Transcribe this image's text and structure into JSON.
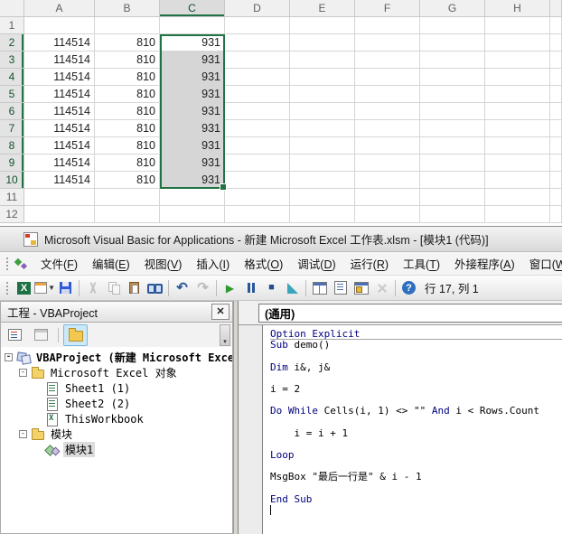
{
  "excel": {
    "columns": [
      "A",
      "B",
      "C",
      "D",
      "E",
      "F",
      "G",
      "H"
    ],
    "row_numbers": [
      "1",
      "2",
      "3",
      "4",
      "5",
      "6",
      "7",
      "8",
      "9",
      "10",
      "11",
      "12"
    ],
    "rows": [
      {
        "n": 2,
        "A": "114514",
        "B": "810",
        "C": "931"
      },
      {
        "n": 3,
        "A": "114514",
        "B": "810",
        "C": "931"
      },
      {
        "n": 4,
        "A": "114514",
        "B": "810",
        "C": "931"
      },
      {
        "n": 5,
        "A": "114514",
        "B": "810",
        "C": "931"
      },
      {
        "n": 6,
        "A": "114514",
        "B": "810",
        "C": "931"
      },
      {
        "n": 7,
        "A": "114514",
        "B": "810",
        "C": "931"
      },
      {
        "n": 8,
        "A": "114514",
        "B": "810",
        "C": "931"
      },
      {
        "n": 9,
        "A": "114514",
        "B": "810",
        "C": "931"
      },
      {
        "n": 10,
        "A": "114514",
        "B": "810",
        "C": "931"
      }
    ],
    "selection": "C2:C10",
    "colors": {
      "accent_green": "#217346",
      "selection_fill": "#d6d6d6"
    }
  },
  "vba": {
    "title": "Microsoft Visual Basic for Applications - 新建 Microsoft Excel 工作表.xlsm - [模块1 (代码)]",
    "menus": [
      "文件(F)",
      "编辑(E)",
      "视图(V)",
      "插入(I)",
      "格式(O)",
      "调试(D)",
      "运行(R)",
      "工具(T)",
      "外接程序(A)",
      "窗口(W)"
    ],
    "toolbar": {
      "items": [
        {
          "name": "view-excel-button",
          "icon": "excel-icon",
          "kind": "ic-excel",
          "glyph": "X"
        },
        {
          "name": "insert-userform-button",
          "icon": "userform-icon",
          "kind": "ic-userform",
          "dropdown": true
        },
        {
          "name": "save-button",
          "icon": "save-icon",
          "kind": "ic-save"
        },
        {
          "sep": true
        },
        {
          "name": "cut-button",
          "icon": "scissors-icon",
          "kind": "ic-cut",
          "disabled": true
        },
        {
          "name": "copy-button",
          "icon": "copy-icon",
          "kind": "ic-copy",
          "disabled": true
        },
        {
          "name": "paste-button",
          "icon": "clipboard-icon",
          "kind": "ic-paste"
        },
        {
          "name": "find-button",
          "icon": "binoculars-icon",
          "kind": "ic-find"
        },
        {
          "sep": true
        },
        {
          "name": "undo-button",
          "icon": "undo-arrow-icon",
          "kind": "g-undo",
          "glyph": "↶"
        },
        {
          "name": "redo-button",
          "icon": "redo-arrow-icon",
          "kind": "g-redo",
          "glyph": "↷",
          "disabled": true
        },
        {
          "sep": true
        },
        {
          "name": "run-button",
          "icon": "play-icon",
          "kind": "g-run",
          "glyph": "▶"
        },
        {
          "name": "break-button",
          "icon": "pause-icon",
          "kind": "ic-break",
          "bars": true
        },
        {
          "name": "reset-button",
          "icon": "stop-icon",
          "kind": "g-reset",
          "glyph": "■"
        },
        {
          "name": "design-mode-button",
          "icon": "design-mode-icon",
          "kind": "ic-design"
        },
        {
          "sep": true
        },
        {
          "name": "project-explorer-button",
          "icon": "project-explorer-icon",
          "kind": "ic-projexp"
        },
        {
          "name": "properties-window-button",
          "icon": "properties-icon",
          "kind": "ic-props"
        },
        {
          "name": "object-browser-button",
          "icon": "object-browser-icon",
          "kind": "ic-objbrowser"
        },
        {
          "name": "toolbox-button",
          "icon": "toolbox-icon",
          "kind": "ic-toolbox",
          "disabled": true
        },
        {
          "sep": true
        },
        {
          "name": "help-button",
          "icon": "help-icon",
          "kind": "ic-help",
          "glyph": "?"
        }
      ],
      "status": "行 17, 列 1"
    },
    "project": {
      "header": "工程 - VBAProject",
      "tree": [
        {
          "icon": "project-icon",
          "kind": "ti-project",
          "label": "VBAProject (新建 Microsoft Excel 工作表.xlsm)",
          "bold": true,
          "level": 0,
          "expander": "-"
        },
        {
          "icon": "folder-icon",
          "kind": "ti-folder",
          "label": "Microsoft Excel 对象",
          "level": 1,
          "expander": "-"
        },
        {
          "icon": "worksheet-icon",
          "kind": "ti-sheet",
          "label": "Sheet1 (1)",
          "level": 2
        },
        {
          "icon": "worksheet-icon",
          "kind": "ti-sheet",
          "label": "Sheet2 (2)",
          "level": 2
        },
        {
          "icon": "workbook-icon",
          "kind": "ti-workbook",
          "label": "ThisWorkbook",
          "level": 2
        },
        {
          "icon": "folder-icon",
          "kind": "ti-folder",
          "label": "模块",
          "level": 1,
          "expander": "-"
        },
        {
          "icon": "module-icon",
          "kind": "ti-module",
          "label": "模块1",
          "level": 2,
          "selected": true
        }
      ]
    },
    "code": {
      "object_dropdown": "(通用)",
      "lines": [
        {
          "seg": [
            [
              "kw",
              "Option Explicit"
            ]
          ],
          "sep": true
        },
        {
          "seg": [
            [
              "kw",
              "Sub"
            ],
            [
              "tx",
              " demo()"
            ]
          ]
        },
        {
          "seg": []
        },
        {
          "seg": [
            [
              "kw",
              "Dim"
            ],
            [
              "tx",
              " i&, j&"
            ]
          ]
        },
        {
          "seg": []
        },
        {
          "seg": [
            [
              "tx",
              "i = 2"
            ]
          ]
        },
        {
          "seg": []
        },
        {
          "seg": [
            [
              "kw",
              "Do While"
            ],
            [
              "tx",
              " Cells(i, 1) <> \"\" "
            ],
            [
              "kw",
              "And"
            ],
            [
              "tx",
              " i < Rows.Count"
            ]
          ]
        },
        {
          "seg": []
        },
        {
          "seg": [
            [
              "tx",
              "    i = i + 1"
            ]
          ]
        },
        {
          "seg": []
        },
        {
          "seg": [
            [
              "kw",
              "Loop"
            ]
          ]
        },
        {
          "seg": []
        },
        {
          "seg": [
            [
              "tx",
              "MsgBox \"最后一行是\" & i - 1"
            ]
          ]
        },
        {
          "seg": []
        },
        {
          "seg": [
            [
              "kw",
              "End Sub"
            ]
          ]
        },
        {
          "seg": [],
          "cursor": true
        }
      ]
    }
  }
}
